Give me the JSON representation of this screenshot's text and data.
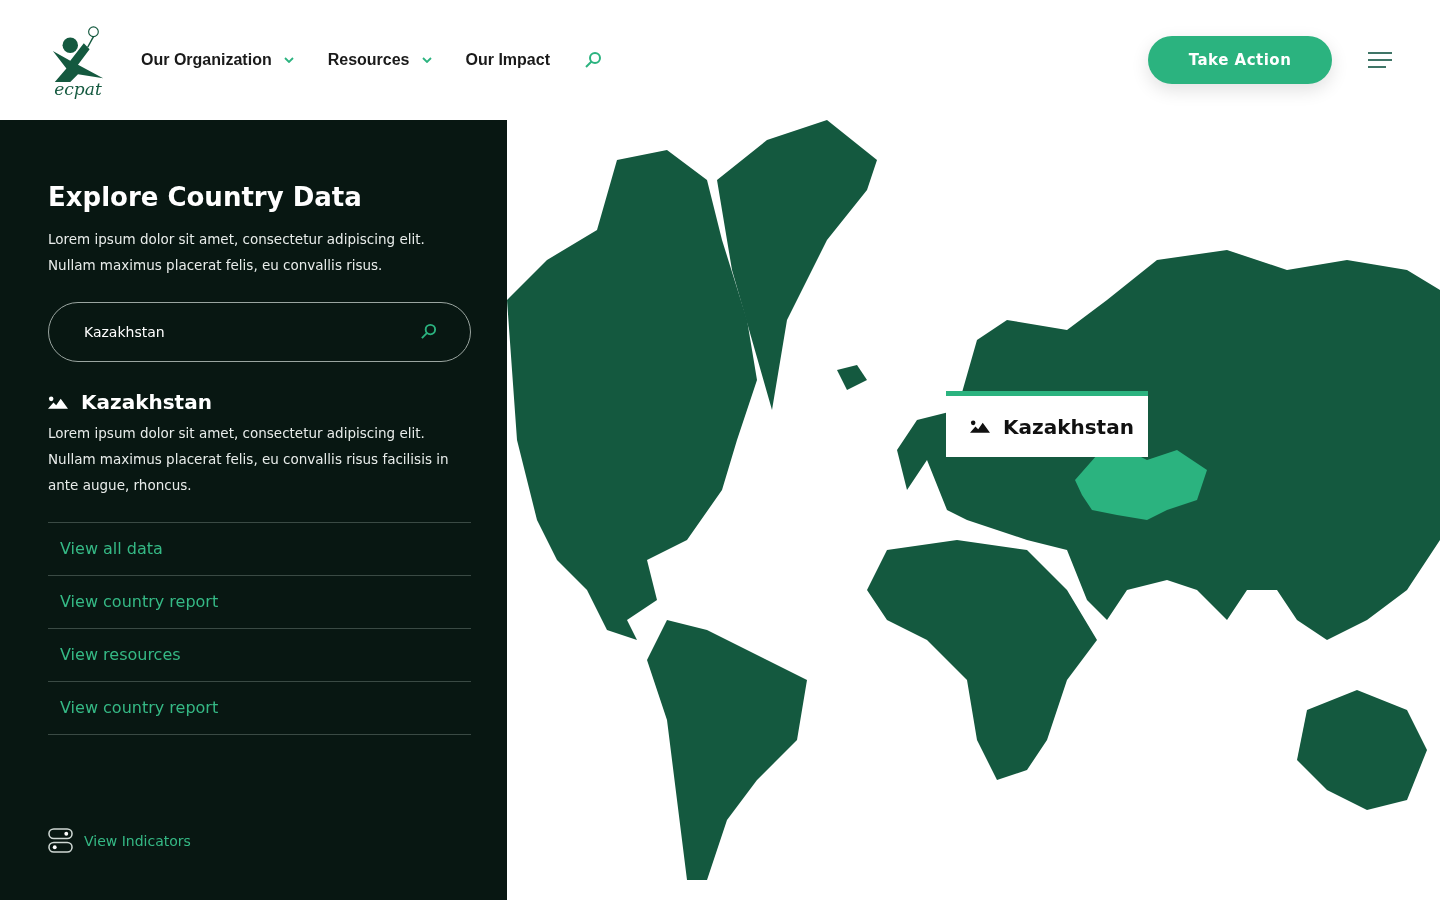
{
  "header": {
    "logo_text": "ecpat",
    "nav": [
      {
        "label": "Our Organization",
        "has_dropdown": true
      },
      {
        "label": "Resources",
        "has_dropdown": true
      },
      {
        "label": "Our Impact",
        "has_dropdown": false
      }
    ],
    "cta": "Take Action"
  },
  "sidebar": {
    "title": "Explore Country Data",
    "intro": "Lorem ipsum dolor sit amet, consectetur adipiscing elit. Nullam maximus placerat felis, eu convallis risus.",
    "search": {
      "value": "Kazakhstan"
    },
    "country": {
      "name": "Kazakhstan",
      "description": "Lorem ipsum dolor sit amet, consectetur adipiscing elit. Nullam maximus placerat felis, eu convallis risus facilisis in ante augue, rhoncus."
    },
    "links": [
      "View all data",
      "View country report",
      "View resources",
      "View country report"
    ],
    "indicators_link": "View Indicators"
  },
  "map": {
    "tooltip": "Kazakhstan"
  }
}
